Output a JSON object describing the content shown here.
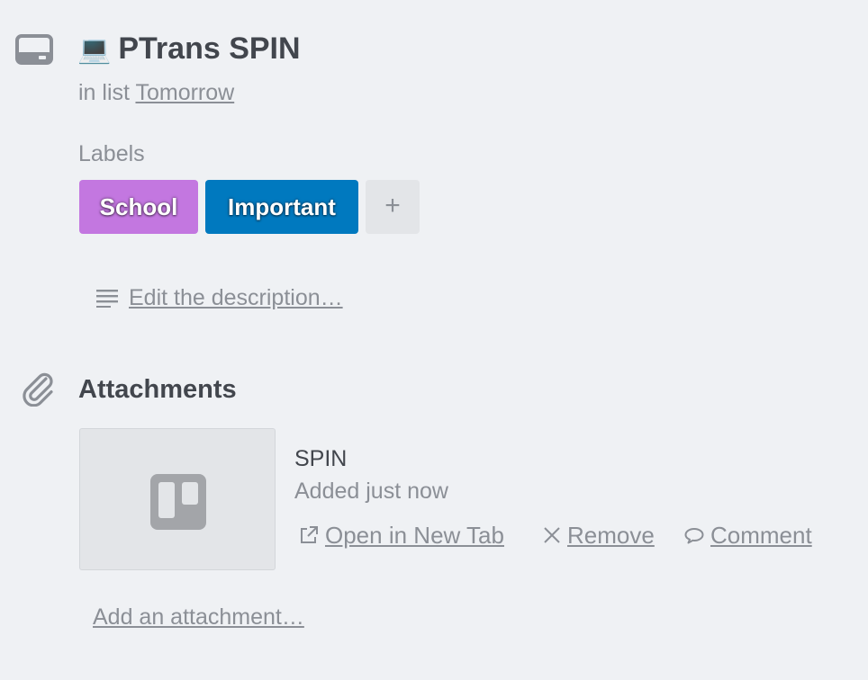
{
  "card": {
    "title_emoji": "💻",
    "title": "PTrans SPIN",
    "in_list_prefix": "in list",
    "list_name": "Tomorrow"
  },
  "labels": {
    "heading": "Labels",
    "items": [
      {
        "name": "School",
        "color": "#c377e0"
      },
      {
        "name": "Important",
        "color": "#0079bf"
      }
    ],
    "add_symbol": "+"
  },
  "description": {
    "link_text": "Edit the description…"
  },
  "attachments": {
    "heading": "Attachments",
    "items": [
      {
        "name": "SPIN",
        "added": "Added just now",
        "actions": {
          "open": "Open in New Tab",
          "remove": "Remove",
          "comment": "Comment"
        }
      }
    ],
    "add_link": "Add an attachment…"
  },
  "colors": {
    "background": "#eff1f4",
    "text_dark": "#42464d",
    "text_muted": "#8b8f96"
  }
}
